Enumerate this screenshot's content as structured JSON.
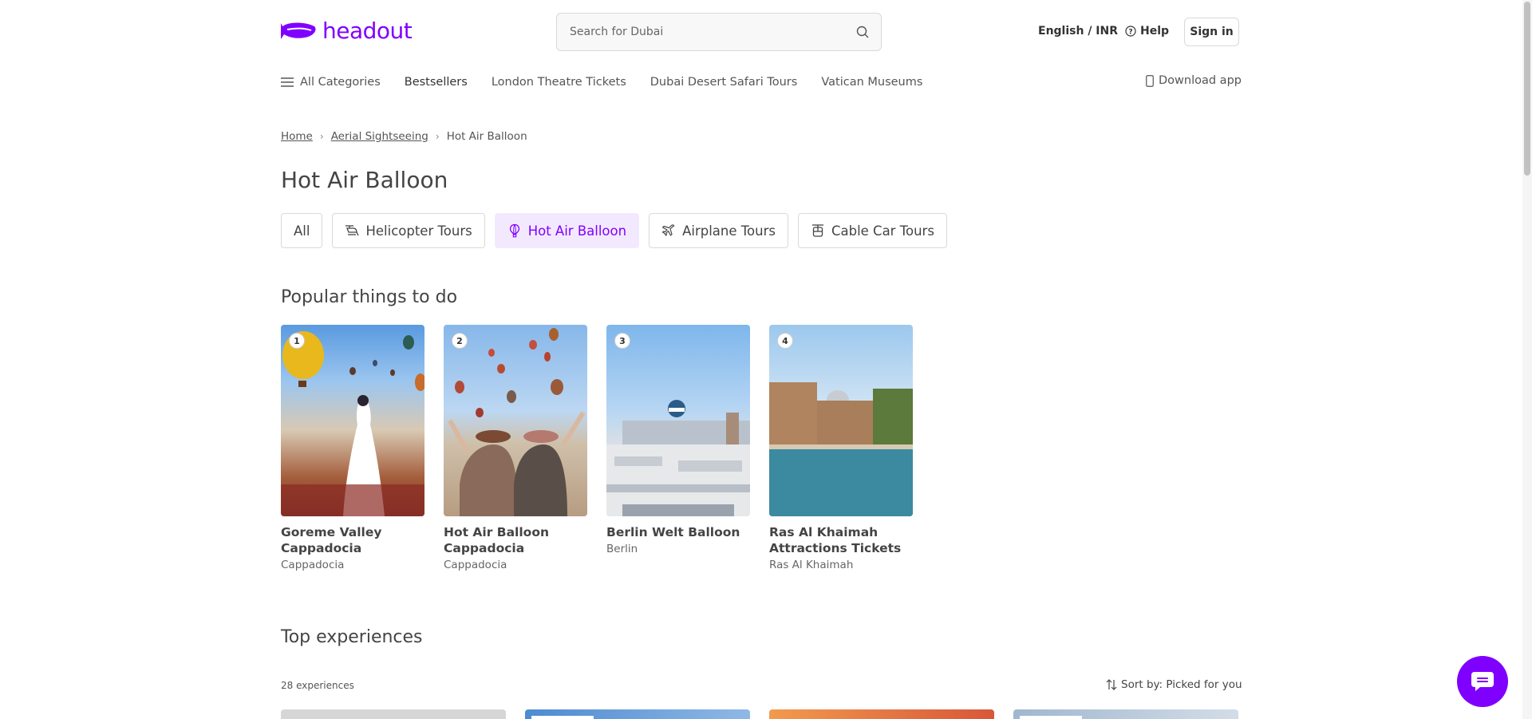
{
  "brand": {
    "name": "headout",
    "color": "#8000ff"
  },
  "search": {
    "placeholder": "Search for Dubai",
    "icon": "search-icon"
  },
  "header": {
    "language": "English / INR",
    "help": "Help",
    "sign_in": "Sign in"
  },
  "nav": {
    "items": [
      {
        "label": "All Categories",
        "icon": "menu-icon"
      },
      {
        "label": "Bestsellers"
      },
      {
        "label": "London Theatre Tickets"
      },
      {
        "label": "Dubai Desert Safari Tours"
      },
      {
        "label": "Vatican Museums"
      }
    ],
    "download": "Download app"
  },
  "breadcrumb": {
    "home": "Home",
    "parent": "Aerial Sightseeing",
    "current": "Hot Air Balloon"
  },
  "page_title": "Hot Air Balloon",
  "categories": [
    {
      "label": "All"
    },
    {
      "label": "Helicopter Tours",
      "icon": "helicopter-icon"
    },
    {
      "label": "Hot Air Balloon",
      "icon": "balloon-icon",
      "active": true
    },
    {
      "label": "Airplane Tours",
      "icon": "airplane-icon"
    },
    {
      "label": "Cable Car Tours",
      "icon": "cable-car-icon"
    }
  ],
  "popular": {
    "title": "Popular things to do",
    "cards": [
      {
        "rank": "1",
        "title": "Goreme Valley Cappadocia",
        "location": "Cappadocia"
      },
      {
        "rank": "2",
        "title": "Hot Air Balloon Cappadocia",
        "location": "Cappadocia"
      },
      {
        "rank": "3",
        "title": "Berlin Welt Balloon",
        "location": "Berlin"
      },
      {
        "rank": "4",
        "title": "Ras Al Khaimah Attractions Tickets",
        "location": "Ras Al Khaimah"
      }
    ]
  },
  "top_experiences": {
    "title": "Top experiences",
    "count": "28 experiences",
    "sort": "Sort by: Picked for you"
  }
}
